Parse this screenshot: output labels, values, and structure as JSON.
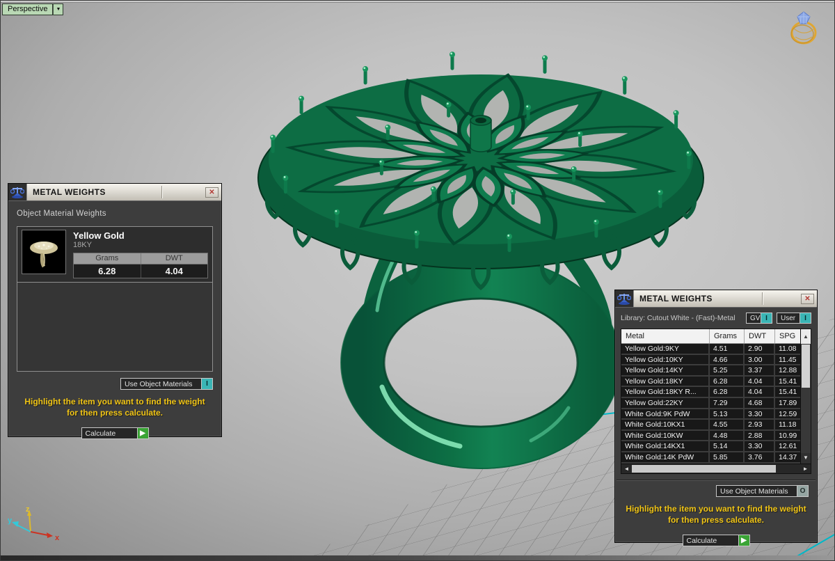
{
  "viewport": {
    "perspective_label": "Perspective",
    "watermark_icon": "gold-ring-with-gem-icon",
    "axis_labels": {
      "x": "x",
      "y": "y",
      "z": "z"
    }
  },
  "icons": {
    "close": "✕",
    "dropdown": "▼",
    "play": "▶",
    "scroll_up": "▲",
    "scroll_down": "▼",
    "scroll_left": "◄",
    "scroll_right": "►",
    "panel_icon": "balance-scale-icon"
  },
  "colors": {
    "model_green": "#0d6f45",
    "hint_yellow": "#f0c415",
    "toggle_teal": "#3ab5b5",
    "calculate_green": "#3aa435",
    "grid_axis_cyan": "#00b8c8",
    "axis_x_red": "#cc3322",
    "axis_y_cyan": "#35c8d8",
    "axis_z_yellow": "#e8c62e"
  },
  "left_panel": {
    "title": "METAL WEIGHTS",
    "section_label": "Object Material Weights",
    "material": {
      "name": "Yellow Gold",
      "karat": "18KY",
      "grams_label": "Grams",
      "dwt_label": "DWT",
      "grams_value": "6.28",
      "dwt_value": "4.04"
    },
    "use_object_materials_label": "Use Object Materials",
    "use_object_materials_state": "I",
    "hint_line1": "Highlight the item you want to find the weight",
    "hint_line2": "for then press calculate.",
    "calculate_label": "Calculate"
  },
  "right_panel": {
    "title": "METAL WEIGHTS",
    "library_label": "Library: Cutout White - (Fast)-Metal",
    "gv_label": "GV",
    "gv_state": "I",
    "user_label": "User",
    "user_state": "I",
    "table": {
      "columns": [
        "Metal",
        "Grams",
        "DWT",
        "SPG"
      ],
      "rows": [
        [
          "Yellow Gold:9KY",
          "4.51",
          "2.90",
          "11.08"
        ],
        [
          "Yellow Gold:10KY",
          "4.66",
          "3.00",
          "11.45"
        ],
        [
          "Yellow Gold:14KY",
          "5.25",
          "3.37",
          "12.88"
        ],
        [
          "Yellow Gold:18KY",
          "6.28",
          "4.04",
          "15.41"
        ],
        [
          "Yellow Gold:18KY R...",
          "6.28",
          "4.04",
          "15.41"
        ],
        [
          "Yellow Gold:22KY",
          "7.29",
          "4.68",
          "17.89"
        ],
        [
          "White Gold:9K PdW",
          "5.13",
          "3.30",
          "12.59"
        ],
        [
          "White Gold:10KX1",
          "4.55",
          "2.93",
          "11.18"
        ],
        [
          "White Gold:10KW",
          "4.48",
          "2.88",
          "10.99"
        ],
        [
          "White Gold:14KX1",
          "5.14",
          "3.30",
          "12.61"
        ],
        [
          "White Gold:14K PdW",
          "5.85",
          "3.76",
          "14.37"
        ]
      ]
    },
    "use_object_materials_label": "Use Object Materials",
    "use_object_materials_state": "O",
    "hint_line1": "Highlight the item you want to find the weight",
    "hint_line2": "for then press calculate.",
    "calculate_label": "Calculate"
  }
}
